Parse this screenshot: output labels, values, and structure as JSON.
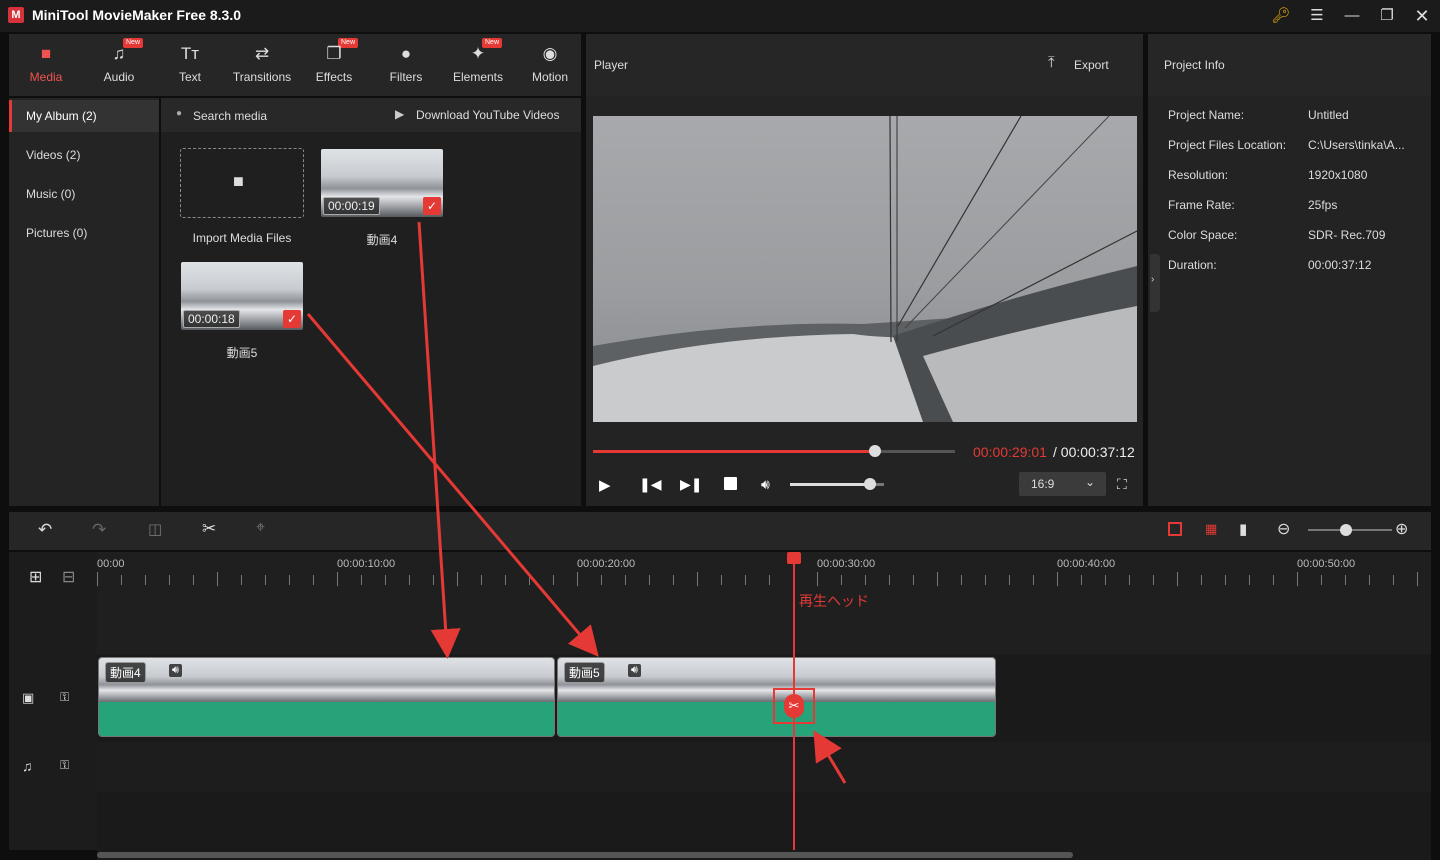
{
  "app": {
    "title": "MiniTool MovieMaker Free 8.3.0"
  },
  "toolbar": {
    "tabs": [
      {
        "label": "Media",
        "icon": "folder-icon",
        "active": true,
        "new": false
      },
      {
        "label": "Audio",
        "icon": "music-icon",
        "active": false,
        "new": true
      },
      {
        "label": "Text",
        "icon": "text-icon",
        "active": false,
        "new": false
      },
      {
        "label": "Transitions",
        "icon": "transitions-icon",
        "active": false,
        "new": false
      },
      {
        "label": "Effects",
        "icon": "effects-icon",
        "active": false,
        "new": true
      },
      {
        "label": "Filters",
        "icon": "filters-icon",
        "active": false,
        "new": false
      },
      {
        "label": "Elements",
        "icon": "elements-icon",
        "active": false,
        "new": true
      },
      {
        "label": "Motion",
        "icon": "motion-icon",
        "active": false,
        "new": false
      }
    ],
    "new_badge": "New"
  },
  "sidebar": {
    "items": [
      "My Album (2)",
      "Videos (2)",
      "Music (0)",
      "Pictures (0)"
    ]
  },
  "media": {
    "search_placeholder": "Search media",
    "download_label": "Download YouTube Videos",
    "import_label": "Import Media Files",
    "items": [
      {
        "name": "動画4",
        "duration": "00:00:19"
      },
      {
        "name": "動画5",
        "duration": "00:00:18"
      }
    ]
  },
  "player": {
    "title": "Player",
    "export_label": "Export",
    "current_time": "00:00:29:01",
    "total_time": "/ 00:00:37:12",
    "progress": 0.78,
    "volume": 0.85,
    "aspect": "16:9"
  },
  "project_info": {
    "title": "Project Info",
    "rows": [
      {
        "label": "Project Name:",
        "value": "Untitled"
      },
      {
        "label": "Project Files Location:",
        "value": "C:\\Users\\tinka\\A..."
      },
      {
        "label": "Resolution:",
        "value": "1920x1080"
      },
      {
        "label": "Frame Rate:",
        "value": "25fps"
      },
      {
        "label": "Color Space:",
        "value": "SDR- Rec.709"
      },
      {
        "label": "Duration:",
        "value": "00:00:37:12"
      }
    ]
  },
  "timeline": {
    "ruler_labels": [
      "00:00",
      "00:00:10:00",
      "00:00:20:00",
      "00:00:30:00",
      "00:00:40:00",
      "00:00:50:00"
    ],
    "clips": [
      {
        "name": "動画4"
      },
      {
        "name": "動画5"
      }
    ],
    "playhead_annotation": "再生ヘッド",
    "zoom": 0.45
  },
  "colors": {
    "accent": "#e53935",
    "wave": "#26a378"
  }
}
